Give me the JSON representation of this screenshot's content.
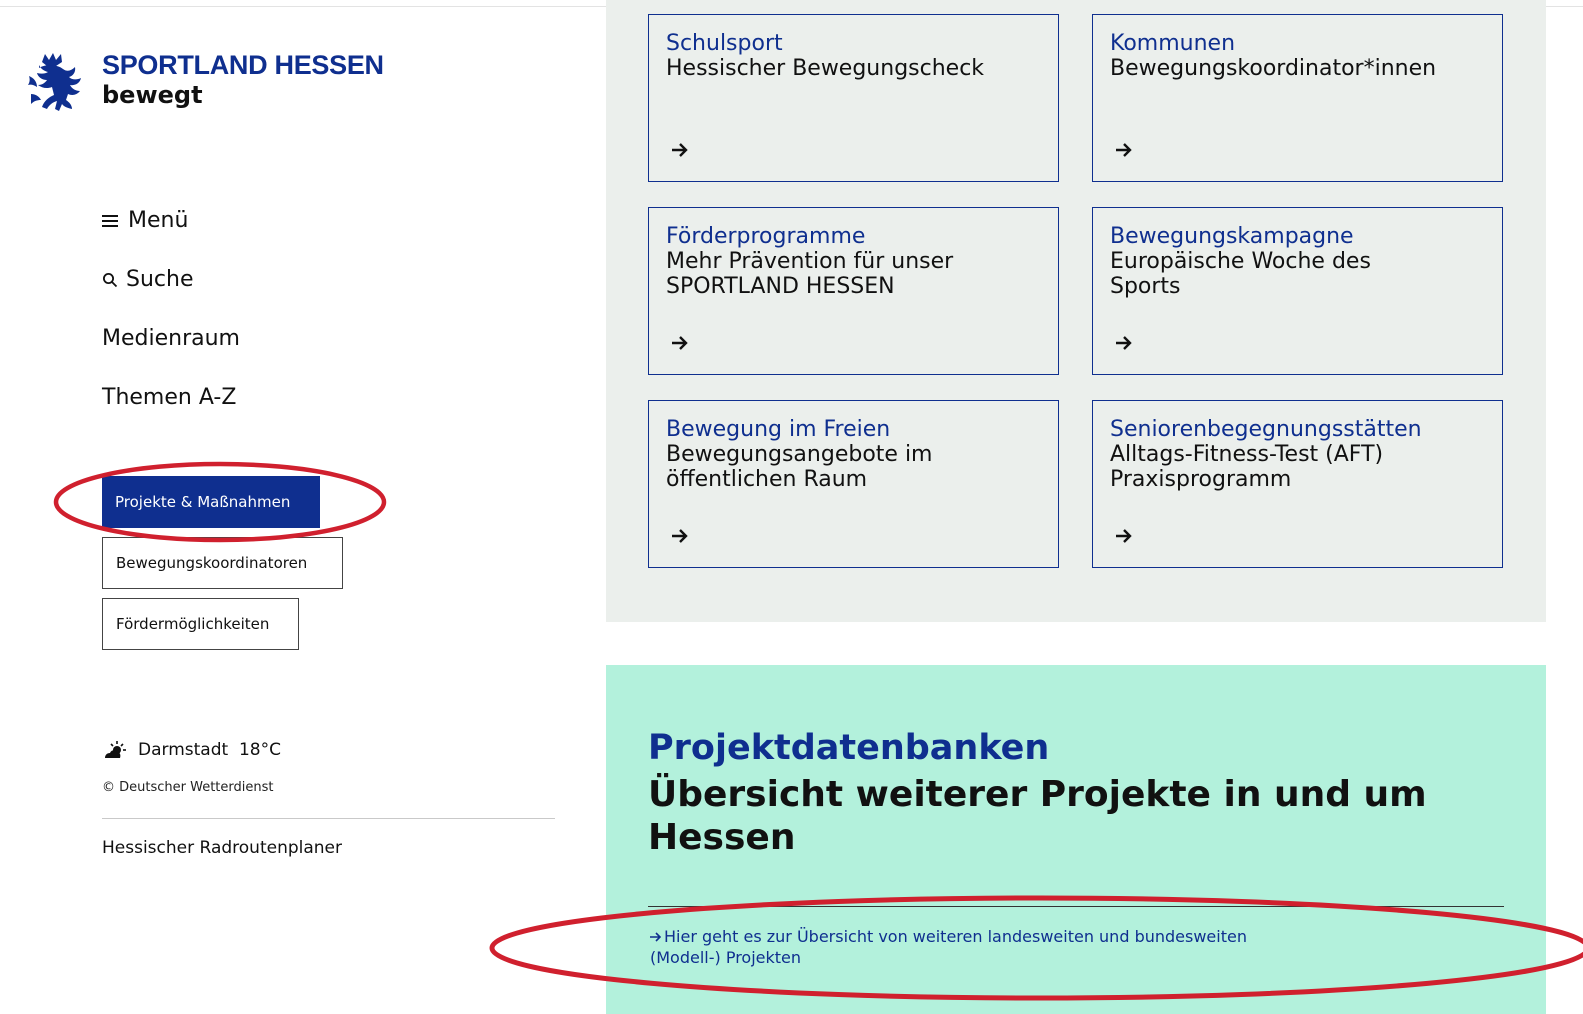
{
  "brand": {
    "title": "SPORTLAND HESSEN",
    "subtitle": "bewegt",
    "logo_icon": "hessen-lion-icon"
  },
  "nav": {
    "menu": "Menü",
    "search": "Suche",
    "media": "Medienraum",
    "topics": "Themen A-Z"
  },
  "subnav": [
    {
      "label": "Projekte & Maßnahmen",
      "active": true
    },
    {
      "label": "Bewegungskoordinatoren",
      "active": false
    },
    {
      "label": "Fördermöglichkeiten",
      "active": false
    }
  ],
  "weather": {
    "icon": "partly-cloudy-sun-icon",
    "text": "Darmstadt  18°C",
    "credit": "© Deutscher Wetterdienst"
  },
  "sidebar_link": "Hessischer Radroutenplaner",
  "tiles": [
    {
      "kicker": "Schulsport",
      "title": "Hessischer Bewegungscheck"
    },
    {
      "kicker": "Kommunen",
      "title": "Bewegungskoordinator*innen"
    },
    {
      "kicker": "Förderprogramme",
      "title": "Mehr Prävention für unser SPORTLAND HESSEN"
    },
    {
      "kicker": "Bewegungskampagne",
      "title": "Europäische Woche des Sports"
    },
    {
      "kicker": "Bewegung im Freien",
      "title": "Bewegungsangebote im öffentlichen Raum"
    },
    {
      "kicker": "Seniorenbegegnungsstätten",
      "title": "Alltags-Fitness-Test (AFT) Praxisprogramm"
    }
  ],
  "databases": {
    "kicker": "Projektdatenbanken",
    "title": "Übersicht weiterer Projekte in und um Hessen",
    "link": "Hier geht es zur Übersicht von weiteren landesweiten und bundesweiten (Modell-) Projekten"
  },
  "colors": {
    "brand_blue": "#0f2f8f",
    "tile_bg": "#ebefec",
    "mint": "#b3f1dc",
    "annotation_red": "#d0202e"
  }
}
